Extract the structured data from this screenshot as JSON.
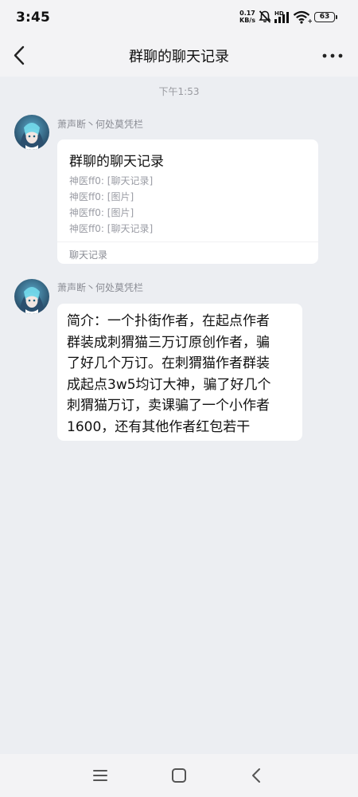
{
  "status_bar": {
    "time": "3:45",
    "net_speed_value": "0.17",
    "net_speed_unit": "KB/s",
    "hd_label": "HD",
    "battery": "63",
    "icons": [
      "mute-icon",
      "signal-icon",
      "wifi-icon",
      "battery-icon"
    ]
  },
  "header": {
    "title": "群聊的聊天记录",
    "back_icon": "chevron-left-icon",
    "more_icon": "more-dots-icon"
  },
  "chat": {
    "timestamp": "下午1:53",
    "messages": [
      {
        "sender": "萧声断丶何处莫凭栏",
        "type": "forwarded-chat-record",
        "card": {
          "title": "群聊的聊天记录",
          "preview": [
            "神医ff0: [聊天记录]",
            "神医ff0: [图片]",
            "神医ff0: [图片]",
            "神医ff0: [聊天记录]"
          ],
          "footer": "聊天记录"
        }
      },
      {
        "sender": "萧声断丶何处莫凭栏",
        "type": "text",
        "lines": [
          "简介：一个扑街作者，在起点作者",
          "群装成刺猬猫三万订原创作者，骗",
          "了好几个万订。在刺猬猫作者群装",
          "成起点3w5均订大神，骗了好几个",
          "刺猬猫万订，卖课骗了一个小作者",
          "1600，还有其他作者红包若干"
        ]
      }
    ]
  },
  "system_nav": {
    "buttons": [
      "menu-icon",
      "home-icon",
      "back-triangle-icon"
    ]
  },
  "colors": {
    "background": "#eceef2",
    "bar": "#f3f3f5",
    "bubble": "#ffffff",
    "secondary_text": "#9a9ca4"
  }
}
